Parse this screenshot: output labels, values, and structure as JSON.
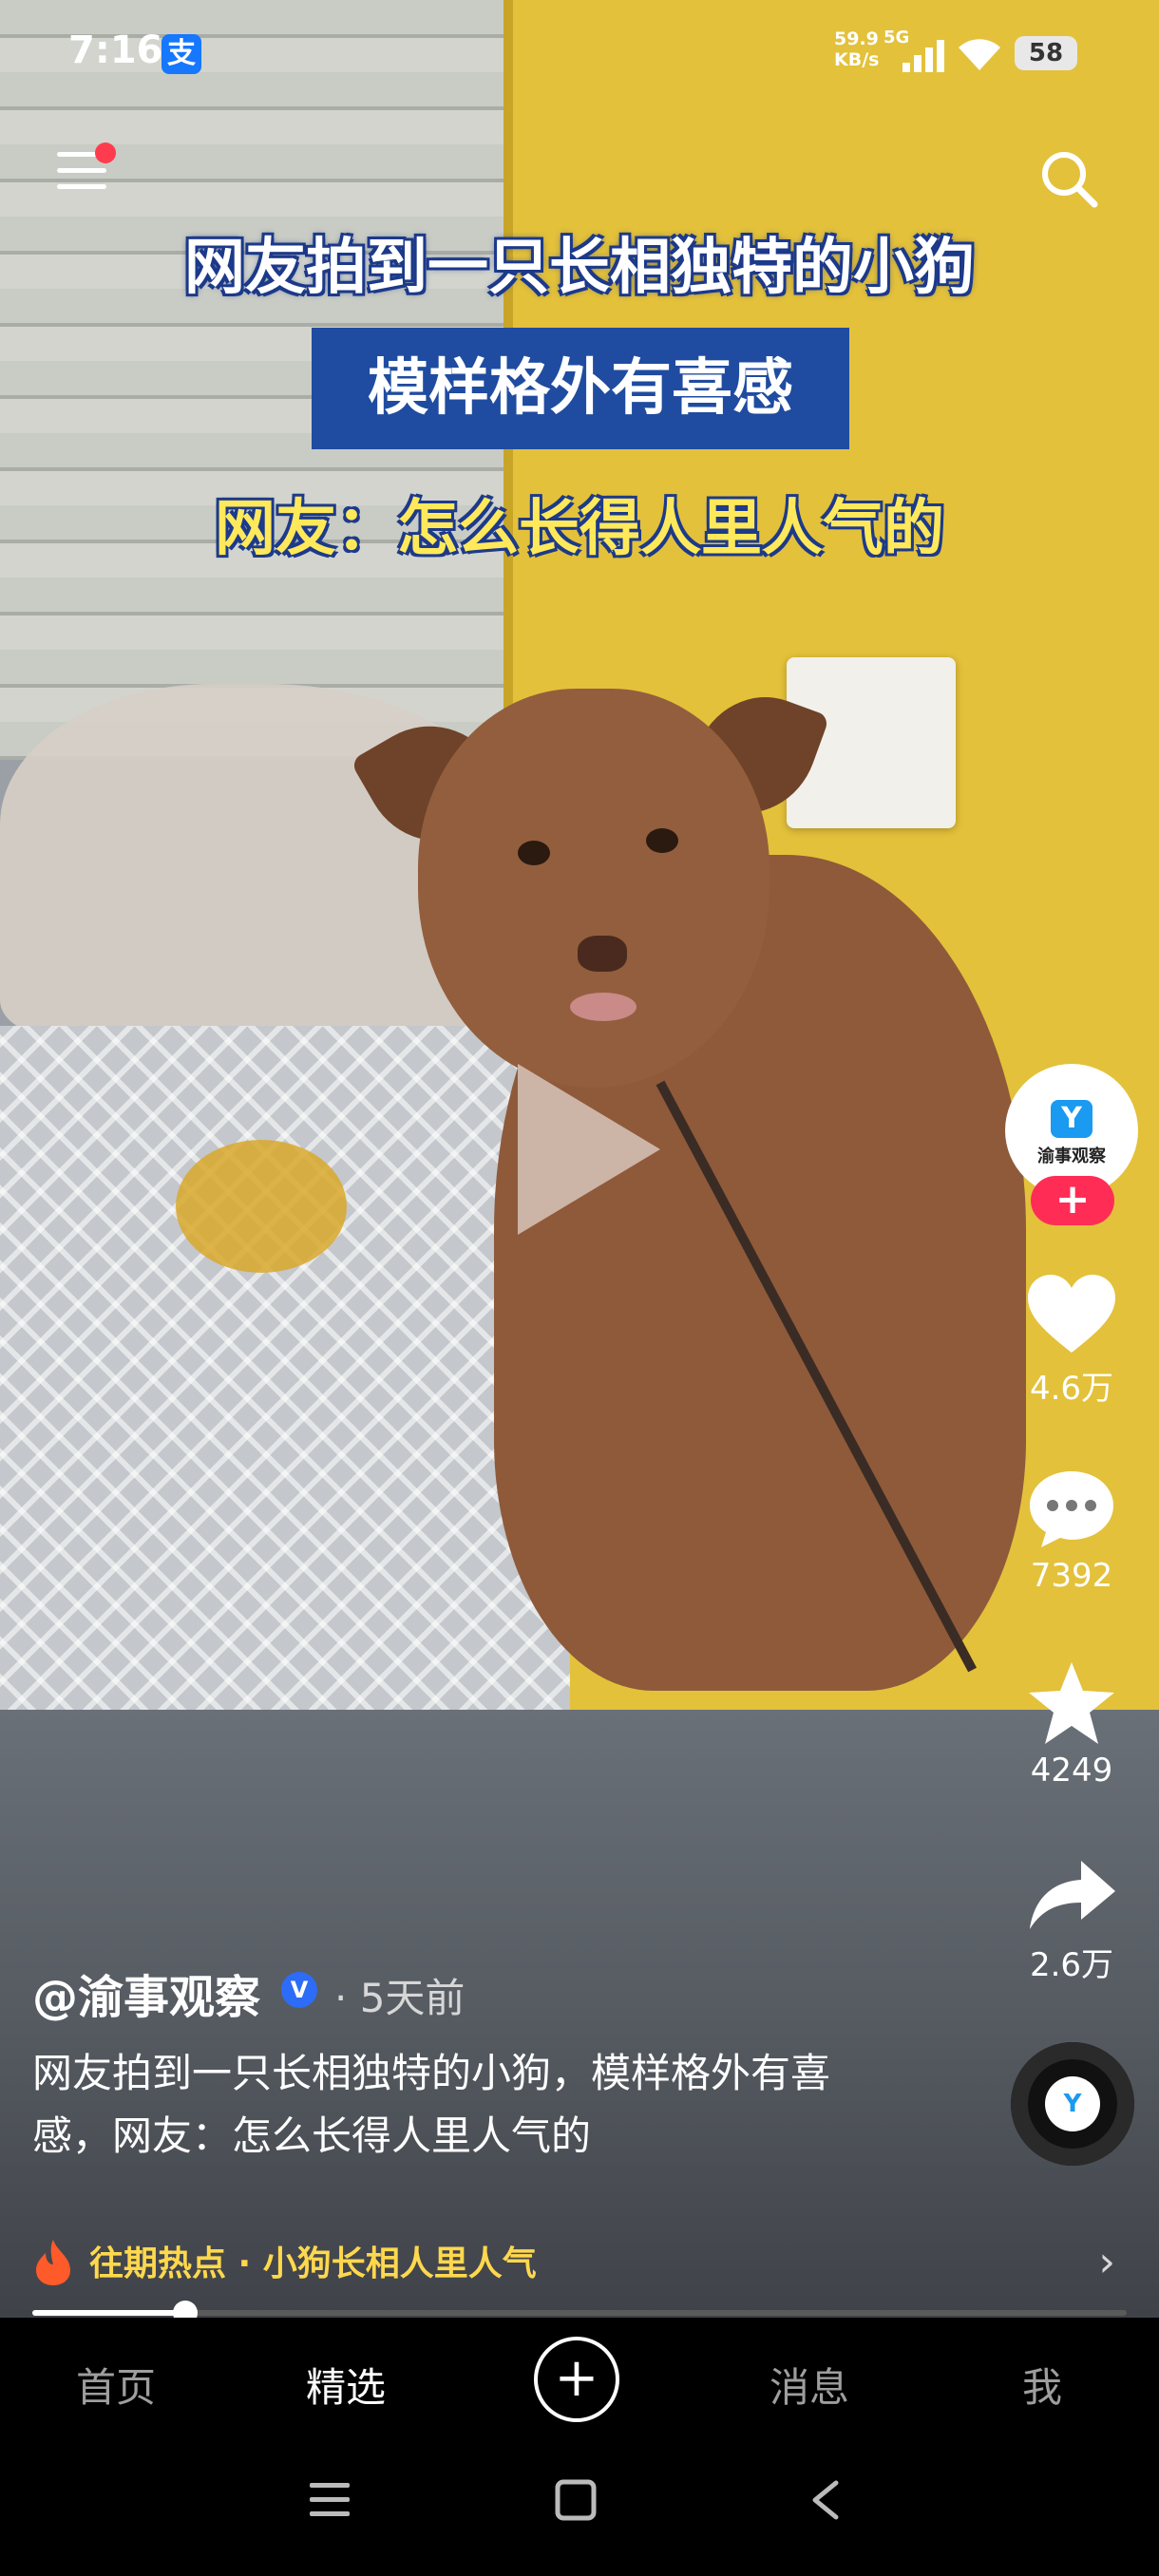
{
  "status_bar": {
    "time": "7:16",
    "alipay_glyph": "支",
    "net_speed_value": "59.9",
    "net_speed_unit": "KB/s",
    "net_type": "5G",
    "battery": "58"
  },
  "overlay_title": {
    "line1": "网友拍到一只长相独特的小狗",
    "line2": "模样格外有喜感",
    "line3": "网友：怎么长得人里人气的"
  },
  "creator": {
    "avatar_glyph": "Y",
    "avatar_name": "渝事观察",
    "follow_label": "+"
  },
  "actions": {
    "like_count": "4.6万",
    "comment_count": "7392",
    "favorite_count": "4249",
    "share_count": "2.6万"
  },
  "post": {
    "author": "@渝事观察",
    "verified_glyph": "V",
    "time_ago": "· 5天前",
    "caption": "网友拍到一只长相独特的小狗，模样格外有喜感，网友：怎么长得人里人气的",
    "hot_topic": "往期热点 · 小狗长相人里人气",
    "hot_chevron": "›"
  },
  "playback": {
    "progress": 0.14
  },
  "music": {
    "disc_glyph": "Y"
  },
  "bottom_nav": {
    "home": "首页",
    "featured": "精选",
    "create": "+",
    "messages": "消息",
    "me": "我"
  },
  "colors": {
    "accent_follow": "#ff2d55",
    "hot_text": "#ffd84d",
    "title_box": "#1f4ca0",
    "title_yellow": "#ffe95a"
  },
  "icons": [
    "menu-icon",
    "search-icon",
    "play-icon",
    "heart-icon",
    "comment-icon",
    "star-icon",
    "share-icon",
    "fire-icon",
    "chevron-right-icon",
    "music-disc-icon",
    "system-menu-icon",
    "system-home-icon",
    "system-back-icon"
  ]
}
